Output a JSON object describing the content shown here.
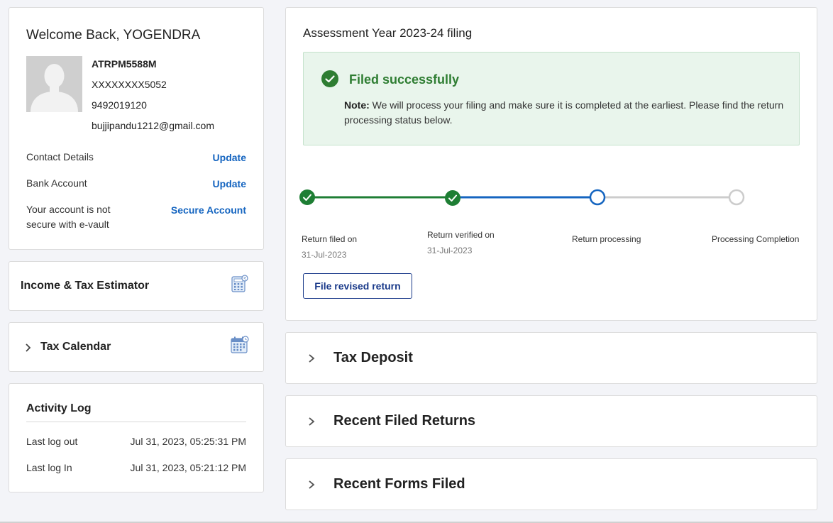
{
  "profile": {
    "welcome": "Welcome Back, YOGENDRA",
    "pan": "ATRPM5588M",
    "aadhaar": "XXXXXXXX5052",
    "phone": "9492019120",
    "email": "bujjipandu1212@gmail.com",
    "contact_label": "Contact Details",
    "contact_action": "Update",
    "bank_label": "Bank Account",
    "bank_action": "Update",
    "evault_label_1": "Your account is not",
    "evault_label_2": "secure with e-vault",
    "evault_action": "Secure Account"
  },
  "estimator": {
    "title": "Income & Tax Estimator",
    "icon": "calculator-icon"
  },
  "calendar": {
    "title": "Tax Calendar",
    "icon": "calendar-icon"
  },
  "activity": {
    "title": "Activity Log",
    "rows": [
      {
        "label": "Last log out",
        "value": "Jul 31, 2023, 05:25:31 PM"
      },
      {
        "label": "Last log In",
        "value": "Jul 31, 2023, 05:21:12 PM"
      }
    ]
  },
  "filing": {
    "title": "Assessment Year 2023-24 filing",
    "status_title": "Filed successfully",
    "note_label": "Note:",
    "note_text": " We will process your filing and make sure it is completed at the earliest. Please find the return processing status below.",
    "steps": [
      {
        "label": "Return filed on",
        "date": "31-Jul-2023",
        "state": "done"
      },
      {
        "label": "Return verified on",
        "date": "31-Jul-2023",
        "state": "done"
      },
      {
        "label": "Return processing",
        "date": "",
        "state": "current"
      },
      {
        "label": "Processing Completion",
        "date": "",
        "state": "pending"
      }
    ],
    "revise_button": "File revised return"
  },
  "accordions": {
    "deposit": "Tax Deposit",
    "returns": "Recent Filed Returns",
    "forms": "Recent Forms Filed"
  },
  "colors": {
    "accent_blue": "#1565c0",
    "success_green": "#2e7d32",
    "step_green": "#1e7e34",
    "pending_gray": "#cccccc"
  }
}
